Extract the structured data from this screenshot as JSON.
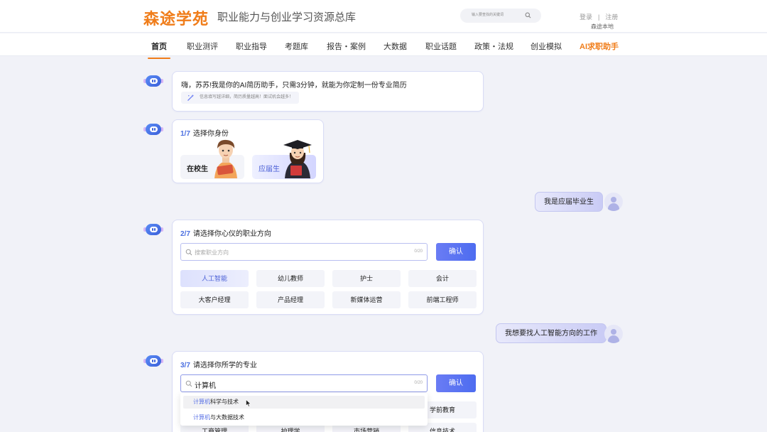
{
  "header": {
    "logo": "森途学苑",
    "slogan": "职业能力与创业学习资源总库",
    "search_placeholder": "输入要查找的关键词",
    "login": "登录",
    "separator": "|",
    "register": "注册",
    "home_link": "森途本地"
  },
  "nav": {
    "items": [
      "首页",
      "职业测评",
      "职业指导",
      "考题库",
      "报告・案例",
      "大数据",
      "职业话题",
      "政策・法规",
      "创业模拟",
      "AI求职助手"
    ],
    "active": "首页"
  },
  "chat": {
    "greeting": {
      "text": "嗨，苏苏!我是你的AI简历助手，只需3分钟，就能为你定制一份专业简历",
      "tip": "信息填写越详细，简历质量越高！面试机会越多！"
    },
    "step1": {
      "num": "1/7",
      "title": "选择你身份",
      "options": [
        "在校生",
        "应届生"
      ],
      "selected": "应届生"
    },
    "reply1": "我是应届毕业生",
    "step2": {
      "num": "2/7",
      "title": "请选择你心仪的职业方向",
      "placeholder": "搜索职业方向",
      "count": "0/20",
      "confirm": "确认",
      "options": [
        "人工智能",
        "幼儿教师",
        "护士",
        "会计",
        "大客户经理",
        "产品经理",
        "新媒体运营",
        "前端工程师"
      ],
      "selected": "人工智能"
    },
    "reply2": "我想要找人工智能方向的工作",
    "step3": {
      "num": "3/7",
      "title": "请选择你所学的专业",
      "value": "计算机",
      "count": "0/20",
      "confirm": "确认",
      "partial_options": [
        "学前教育",
        "工商管理",
        "护理学",
        "市场营销",
        "信息技术"
      ],
      "suggestions": [
        {
          "highlight": "计算机",
          "rest": "科学与技术"
        },
        {
          "highlight": "计算机",
          "rest": "与大数据技术"
        }
      ]
    }
  },
  "colors": {
    "brand_orange": "#f07d1a",
    "accent_blue": "#4d6cf0"
  }
}
